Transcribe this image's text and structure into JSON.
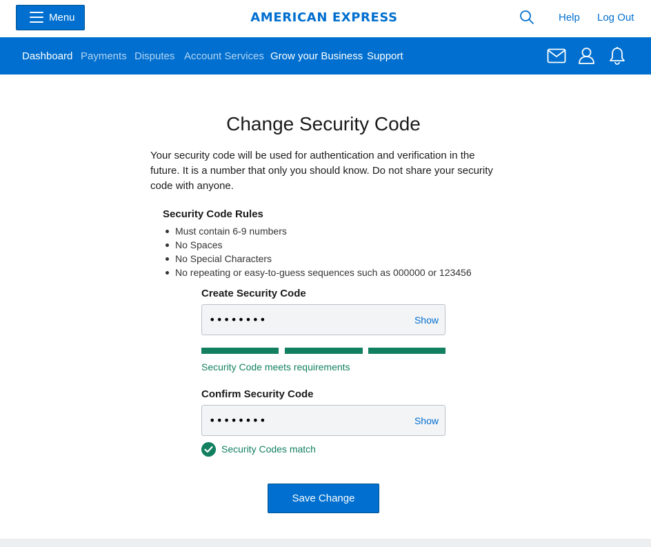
{
  "header": {
    "menu_label": "Menu",
    "brand": "AMERICAN EXPRESS",
    "help_label": "Help",
    "logout_label": "Log Out"
  },
  "nav": {
    "items": [
      "Dashboard",
      "Payments",
      "Disputes",
      "Account Services",
      "Grow your Business",
      "Support"
    ],
    "icons": [
      "mail-icon",
      "profile-icon",
      "bell-icon"
    ]
  },
  "main": {
    "title": "Change Security Code",
    "intro": "Your security code will be used for authentication and verification in the future. It is a number that only you should know. Do not share your security code with anyone.",
    "rules_heading": "Security Code Rules",
    "rules": [
      "Must contain 6-9 numbers",
      "No Spaces",
      "No Special Characters",
      "No repeating or easy-to-guess sequences such as 000000 or 123456"
    ],
    "create": {
      "label": "Create Security Code",
      "value": "••••••••",
      "show_label": "Show",
      "strength_segments_filled": 3,
      "strength_message": "Security Code meets requirements"
    },
    "confirm": {
      "label": "Confirm Security Code",
      "value": "••••••••",
      "show_label": "Show",
      "match_message": "Security Codes match"
    },
    "save_label": "Save Change"
  },
  "colors": {
    "brand_blue": "#006fcf",
    "success_green": "#128060"
  }
}
